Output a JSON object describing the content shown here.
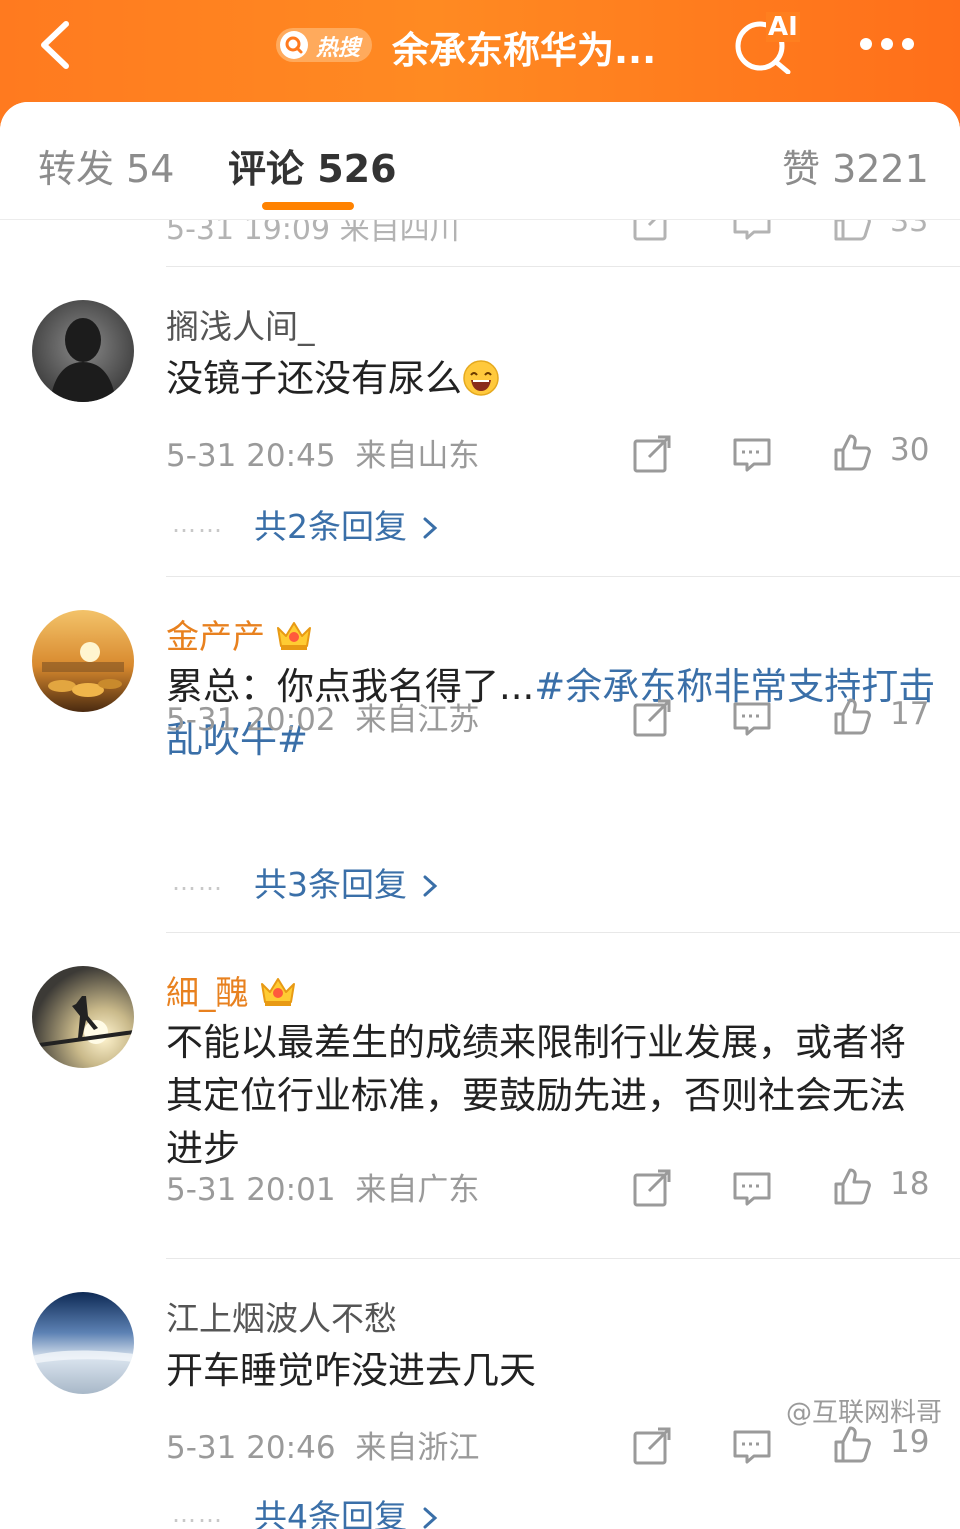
{
  "header": {
    "hot_badge_label": "热搜",
    "title": "余承东称华为...",
    "ai_label": "AI",
    "back_icon": "chevron-left-icon",
    "more_icon": "more-dots-icon"
  },
  "tabs": [
    {
      "label": "转发 54"
    },
    {
      "label": "评论 526"
    },
    {
      "label": "赞 3221"
    }
  ],
  "partial_row": {
    "meta": "5-31 19:09 来自四川",
    "likes": "33"
  },
  "comments": [
    {
      "username": "搁浅人间_",
      "text": "没镜子还没有尿么",
      "time": "5-31 20:45",
      "location": "来自山东",
      "likes": "30",
      "replies": "共2条回复"
    },
    {
      "username": "金产产",
      "text_prefix": "累总：你点我名得了...",
      "hashtag": "#余承东称非常支持打击乱吹牛#",
      "time": "5-31 20:02",
      "location": "来自江苏",
      "likes": "17",
      "replies": "共3条回复"
    },
    {
      "username": "細_醜",
      "text": "不能以最差生的成绩来限制行业发展，或者将其定位行业标准，要鼓励先进，否则社会无法进步",
      "time": "5-31 20:01",
      "location": "来自广东",
      "likes": "18"
    },
    {
      "username": "江上烟波人不愁",
      "text": "开车睡觉咋没进去几天",
      "time": "5-31 20:46",
      "location": "来自浙江",
      "likes": "19",
      "replies": "共4条回复"
    }
  ],
  "watermark": "@互联网料哥",
  "colors": {
    "brand_orange": "#ff8200",
    "link_blue": "#3a6fa8",
    "vip_name": "#e8811f"
  }
}
